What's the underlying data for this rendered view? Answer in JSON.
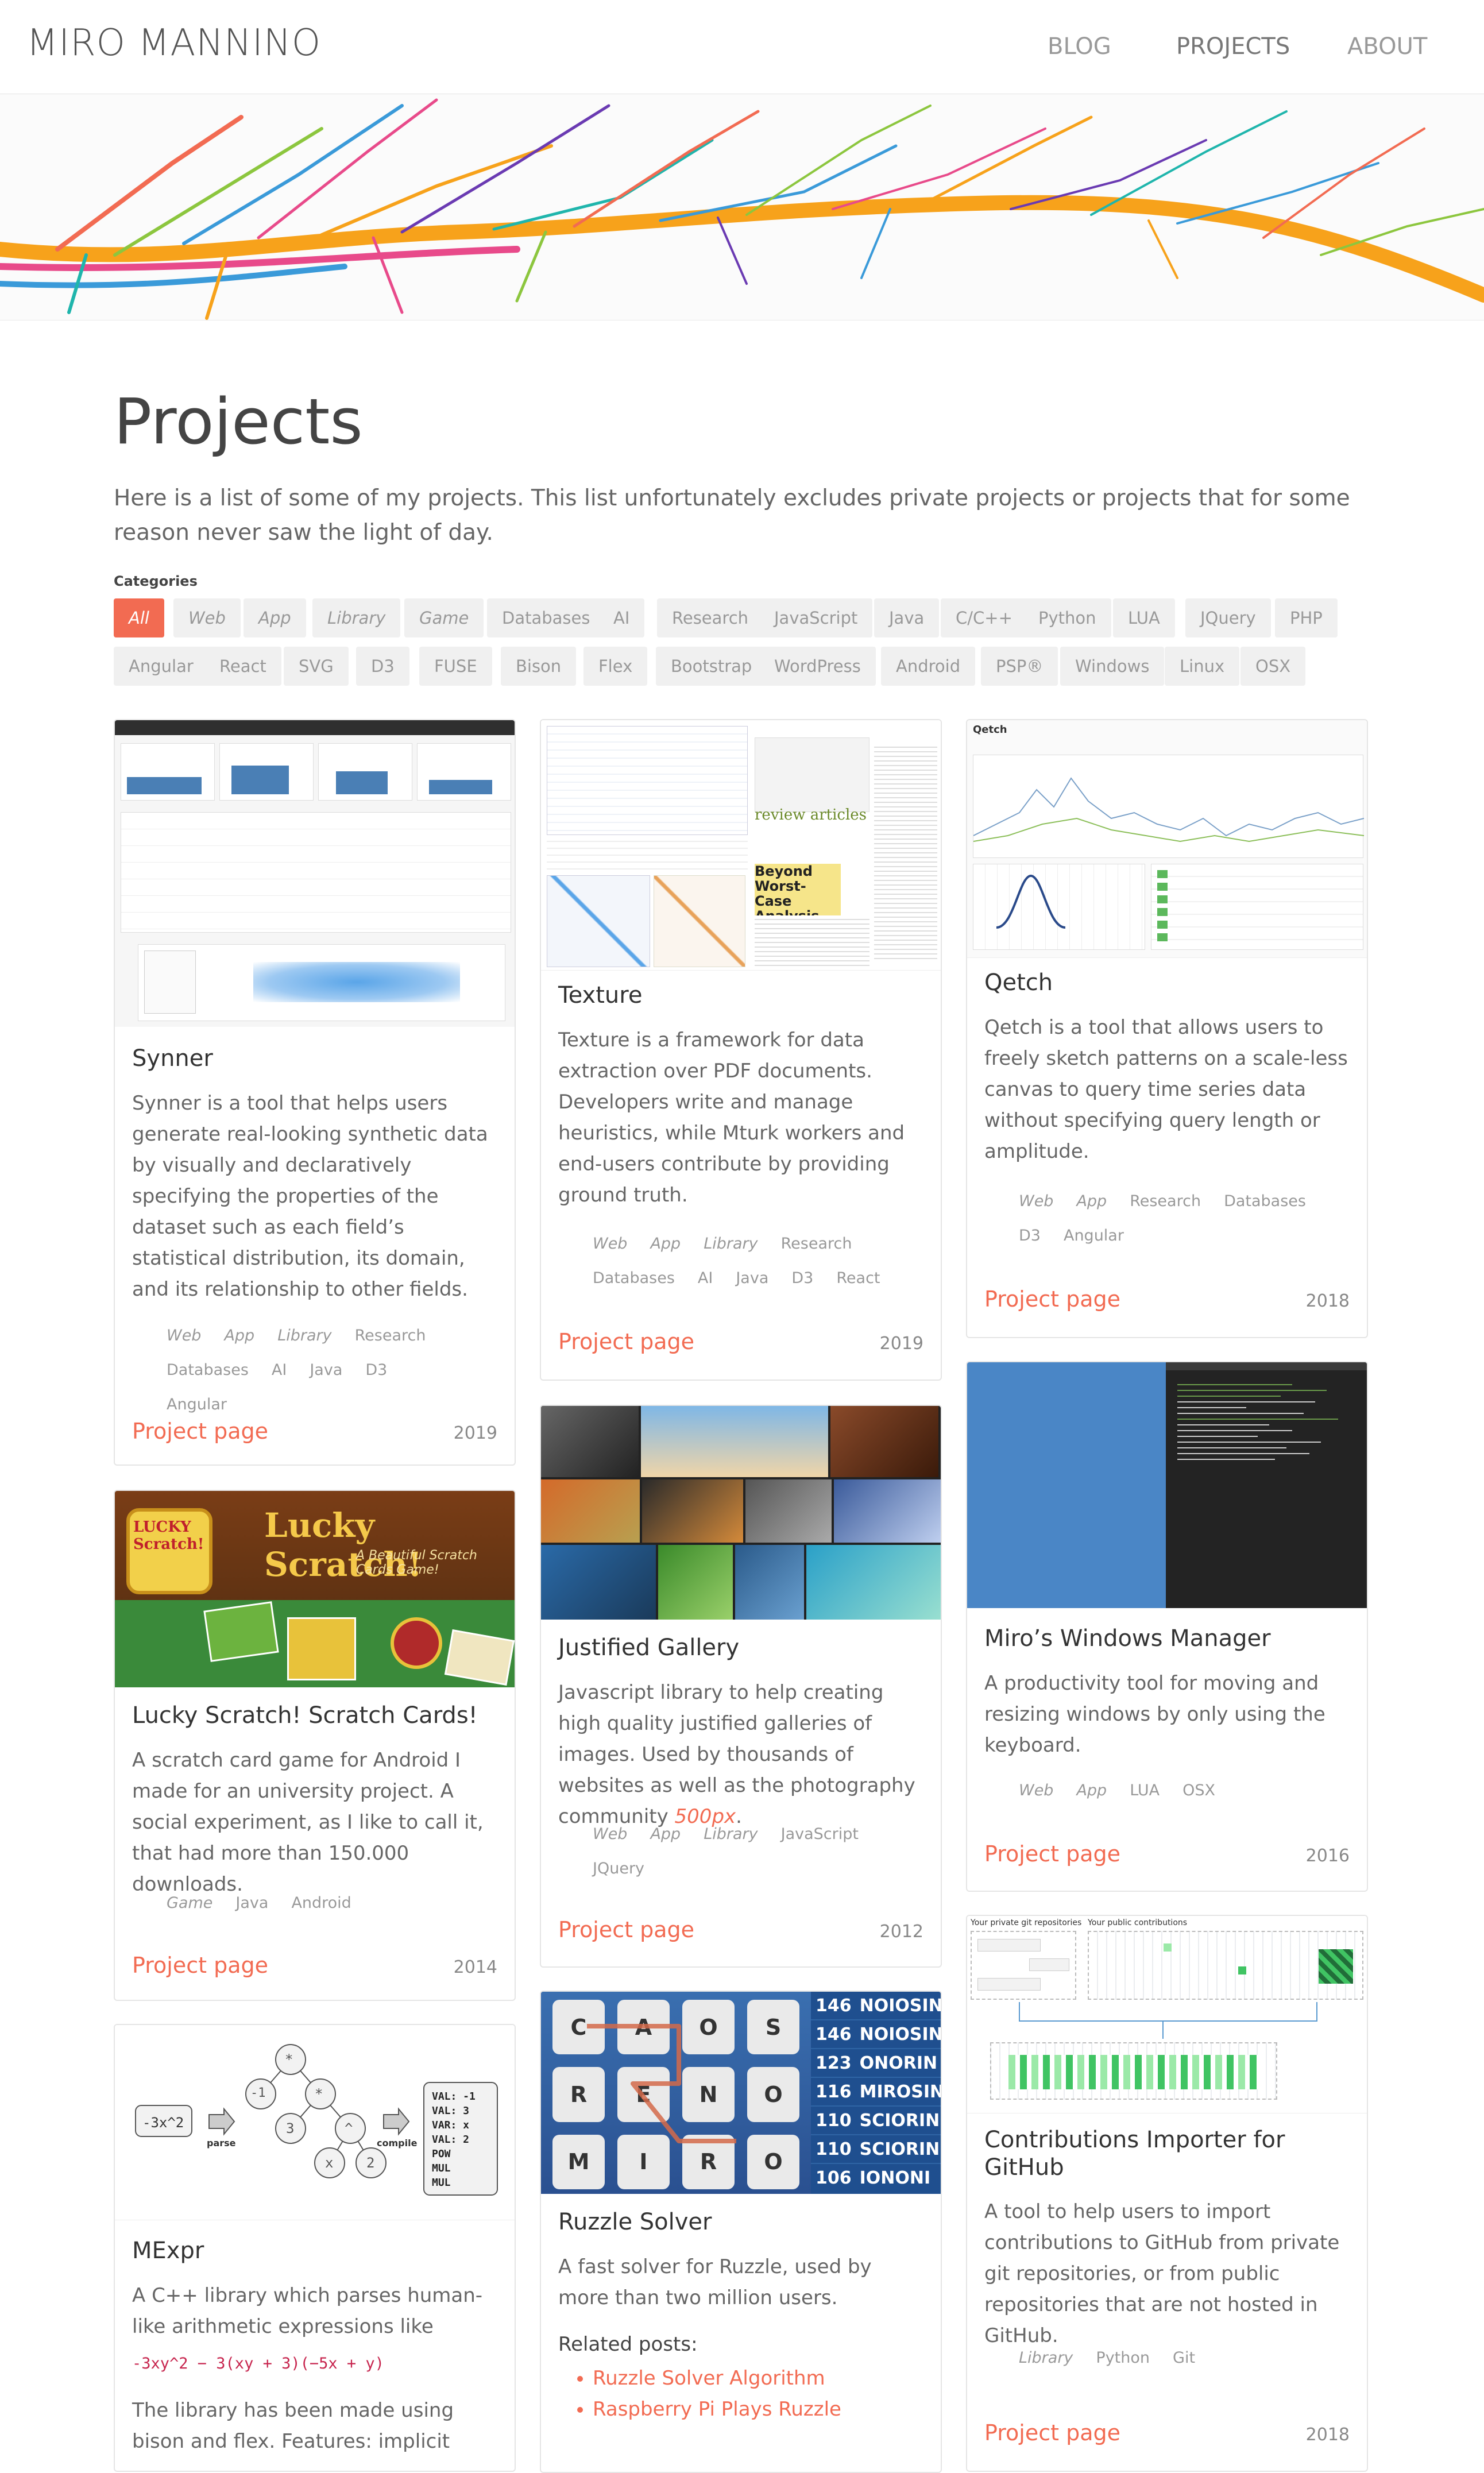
{
  "site": {
    "brand": "MIRO MANNINO",
    "nav": [
      {
        "label": "BLOG"
      },
      {
        "label": "PROJECTS"
      },
      {
        "label": "ABOUT"
      }
    ]
  },
  "page": {
    "title": "Projects",
    "intro": "Here is a list of some of my projects. This list unfortunately excludes private projects or projects that for some reason never saw the light of day.",
    "categories_label": "Categories",
    "categories": [
      "All",
      "Web",
      "App",
      "Library",
      "Game",
      "Databases",
      "AI",
      "Research",
      "JavaScript",
      "Java",
      "C/C++",
      "Python",
      "LUA",
      "JQuery",
      "PHP",
      "Angular",
      "React",
      "SVG",
      "D3",
      "FUSE",
      "Bison",
      "Flex",
      "Bootstrap",
      "WordPress",
      "Android",
      "PSP®",
      "Windows",
      "Linux",
      "OSX"
    ]
  },
  "projects": {
    "synner": {
      "title": "Synner",
      "desc": "Synner is a tool that helps users generate real-looking synthetic data by visually and declaratively specifying the properties of the dataset such as each field’s statistical distribution, its domain, and its relationship to other fields.",
      "tags": [
        "Web",
        "App",
        "Library",
        "Research",
        "Databases",
        "AI",
        "Java",
        "D3",
        "Angular"
      ],
      "link": "Project page",
      "year": "2019"
    },
    "texture": {
      "title": "Texture",
      "desc": "Texture is a framework for data extraction over PDF documents. Developers write and manage heuristics, while Mturk workers and end-users contribute by providing ground truth.",
      "tags": [
        "Web",
        "App",
        "Library",
        "Research",
        "Databases",
        "AI",
        "Java",
        "D3",
        "React"
      ],
      "link": "Project page",
      "year": "2019",
      "thumb_text_1": "review articles",
      "thumb_text_2": "Beyond Worst-Case Analysis"
    },
    "qetch": {
      "title": "Qetch",
      "desc": "Qetch is a tool that allows users to freely sketch patterns on a scale-less canvas to query time series data without specifying query length or amplitude.",
      "tags": [
        "Web",
        "App",
        "Research",
        "Databases",
        "D3",
        "Angular"
      ],
      "link": "Project page",
      "year": "2018",
      "thumb_label": "Qetch"
    },
    "lucky": {
      "title": "Lucky Scratch! Scratch Cards!",
      "desc": "A scratch card game for Android I made for an university project. A social experiment, as I like to call it, that had more than 150.000 downloads.",
      "tags": [
        "Game",
        "Java",
        "Android"
      ],
      "link": "Project page",
      "year": "2014",
      "thumb_title": "Lucky Scratch!",
      "thumb_sub": "A Beautiful Scratch Cards Game!",
      "thumb_icon": "LUCKY Scratch!"
    },
    "gallery": {
      "title": "Justified Gallery",
      "desc_before": "Javascript library to help creating high quality justified galleries of images. Used by thousands of websites as well as the photography community ",
      "desc_link": "500px",
      "desc_after": ".",
      "tags": [
        "Web",
        "App",
        "Library",
        "JavaScript",
        "JQuery"
      ],
      "link": "Project page",
      "year": "2012"
    },
    "windows": {
      "title": "Miro’s Windows Manager",
      "desc": "A productivity tool for moving and resizing windows by only using the keyboard.",
      "tags": [
        "Web",
        "App",
        "LUA",
        "OSX"
      ],
      "link": "Project page",
      "year": "2016"
    },
    "mexpr": {
      "title": "MExpr",
      "desc": "A C++ library which parses human-like arithmetic expressions like",
      "code": "-3xy^2 − 3(xy + 3)(−5x + y)",
      "desc2": "The library has been made using bison and flex. Features: implicit",
      "thumb_input": "-3x^2",
      "thumb_parse": "parse",
      "thumb_compile": "compile",
      "tree": [
        "*",
        "-1",
        "*",
        "3",
        "^",
        "x",
        "2"
      ],
      "asm": [
        "VAL: -1",
        "VAL: 3",
        "VAR: x",
        "VAL: 2",
        "POW",
        "MUL",
        "MUL"
      ]
    },
    "ruzzle": {
      "title": "Ruzzle Solver",
      "desc": "A fast solver for Ruzzle, used by more than two million users.",
      "related_label": "Related posts:",
      "related": [
        "Ruzzle Solver Algorithm",
        "Raspberry Pi Plays Ruzzle"
      ],
      "letters": [
        "C",
        "A",
        "O",
        "S",
        "R",
        "E",
        "N",
        "O",
        "M",
        "I",
        "R",
        "O"
      ],
      "scores": [
        {
          "n": "146",
          "w": "NOIOSIN"
        },
        {
          "n": "146",
          "w": "NOIOSIN"
        },
        {
          "n": "123",
          "w": "ONORIN"
        },
        {
          "n": "116",
          "w": "MIROSIN"
        },
        {
          "n": "110",
          "w": "SCIORIN"
        },
        {
          "n": "110",
          "w": "SCIORIN"
        },
        {
          "n": "106",
          "w": "IONONI"
        }
      ]
    },
    "github": {
      "title": "Contributions Importer for GitHub",
      "desc": "A tool to help users to import contributions to GitHub from private git repositories, or from public repositories that are not hosted in GitHub.",
      "tags": [
        "Library",
        "Python",
        "Git"
      ],
      "link": "Project page",
      "year": "2018",
      "thumb_left": "Your private git repositories",
      "thumb_right": "Your public contributions"
    }
  },
  "colors": {
    "accent": "#f26b52",
    "chip_bg": "#f0f0f0"
  }
}
